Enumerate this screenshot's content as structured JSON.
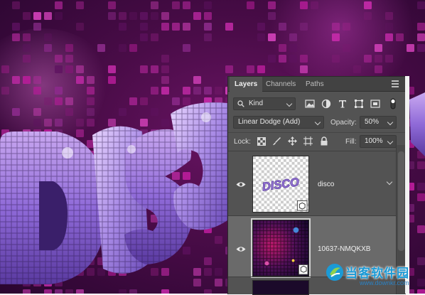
{
  "panel": {
    "tabs": [
      {
        "label": "Layers",
        "active": true
      },
      {
        "label": "Channels",
        "active": false
      },
      {
        "label": "Paths",
        "active": false
      }
    ],
    "filter": {
      "kind_label": "Kind"
    },
    "blend_mode": "Linear Dodge (Add)",
    "opacity": {
      "label": "Opacity:",
      "value": "50%"
    },
    "lock_label": "Lock:",
    "fill": {
      "label": "Fill:",
      "value": "100%"
    },
    "layers": [
      {
        "name": "disco",
        "visible": true,
        "thumb_text": "DISCO"
      },
      {
        "name": "10637-NMQKXB",
        "visible": true,
        "selected": true
      }
    ]
  },
  "watermark": {
    "text": "当客软件园",
    "url": "www.downkr.com"
  },
  "colors": {
    "panel_bg": "#535353",
    "panel_tabs": "#424242",
    "artwork_bg": "#4a0c48",
    "tile_magenta": "#c0189e",
    "watermark_blue": "#1b9ad6"
  }
}
